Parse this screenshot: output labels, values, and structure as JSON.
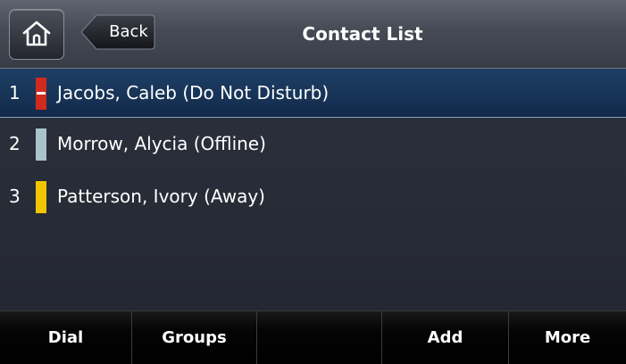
{
  "header": {
    "home_icon": "home-icon",
    "back_label": "Back",
    "title": "Contact List"
  },
  "contacts": [
    {
      "number": "1",
      "name": "Jacobs, Caleb (Do Not Disturb)",
      "status": "Do Not Disturb",
      "status_color": "#d02a1e",
      "selected": true
    },
    {
      "number": "2",
      "name": "Morrow, Alycia (Offline)",
      "status": "Offline",
      "status_color": "#a8c3c9",
      "selected": false
    },
    {
      "number": "3",
      "name": "Patterson, Ivory (Away)",
      "status": "Away",
      "status_color": "#f2c500",
      "selected": false
    }
  ],
  "softkeys": {
    "dial": "Dial",
    "groups": "Groups",
    "empty": "",
    "add": "Add",
    "more": "More"
  },
  "colors": {
    "header_bg": "#4a4f5a",
    "list_bg": "#2b2f3a",
    "selected_bg": "#173457",
    "softkey_bg": "#000000"
  }
}
